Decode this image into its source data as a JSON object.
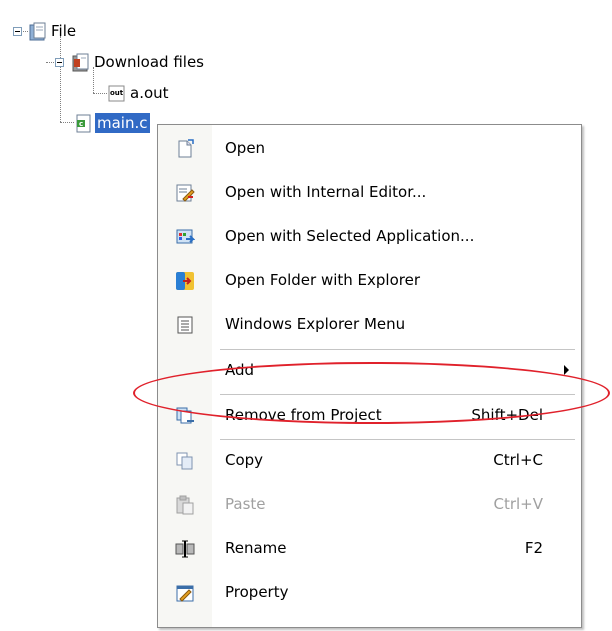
{
  "tree": {
    "root": {
      "label": "File",
      "icon": "folder-file-icon"
    },
    "download_folder": {
      "label": "Download files",
      "icon": "download-folder-icon"
    },
    "aout": {
      "label": "a.out",
      "icon": "out-file-icon",
      "icon_text": "out"
    },
    "mainc": {
      "label": "main.c",
      "icon": "c-source-file-icon",
      "icon_text": "c"
    }
  },
  "menu": {
    "items": [
      {
        "label": "Open",
        "shortcut": "",
        "icon": "open-icon",
        "enabled": true
      },
      {
        "label": "Open with Internal Editor...",
        "shortcut": "",
        "icon": "internal-editor-icon",
        "enabled": true
      },
      {
        "label": "Open with Selected Application...",
        "shortcut": "",
        "icon": "selected-application-icon",
        "enabled": true
      },
      {
        "label": "Open Folder with Explorer",
        "shortcut": "",
        "icon": "explorer-folder-icon",
        "enabled": true
      },
      {
        "label": "Windows Explorer Menu",
        "shortcut": "",
        "icon": "explorer-menu-icon",
        "enabled": true
      },
      {
        "label": "Add",
        "shortcut": "",
        "icon": "",
        "enabled": true,
        "submenu": true
      },
      {
        "label": "Remove from Project",
        "shortcut": "Shift+Del",
        "icon": "remove-from-project-icon",
        "enabled": true,
        "highlighted": true
      },
      {
        "label": "Copy",
        "shortcut": "Ctrl+C",
        "icon": "copy-icon",
        "enabled": true
      },
      {
        "label": "Paste",
        "shortcut": "Ctrl+V",
        "icon": "paste-icon",
        "enabled": false
      },
      {
        "label": "Rename",
        "shortcut": "F2",
        "icon": "rename-icon",
        "enabled": true
      },
      {
        "label": "Property",
        "shortcut": "",
        "icon": "property-icon",
        "enabled": true
      }
    ]
  },
  "colors": {
    "selection": "#316ac5",
    "annotation": "#e0212b",
    "disabled_text": "#a0a0a0",
    "menu_border": "#8c8c8c"
  }
}
